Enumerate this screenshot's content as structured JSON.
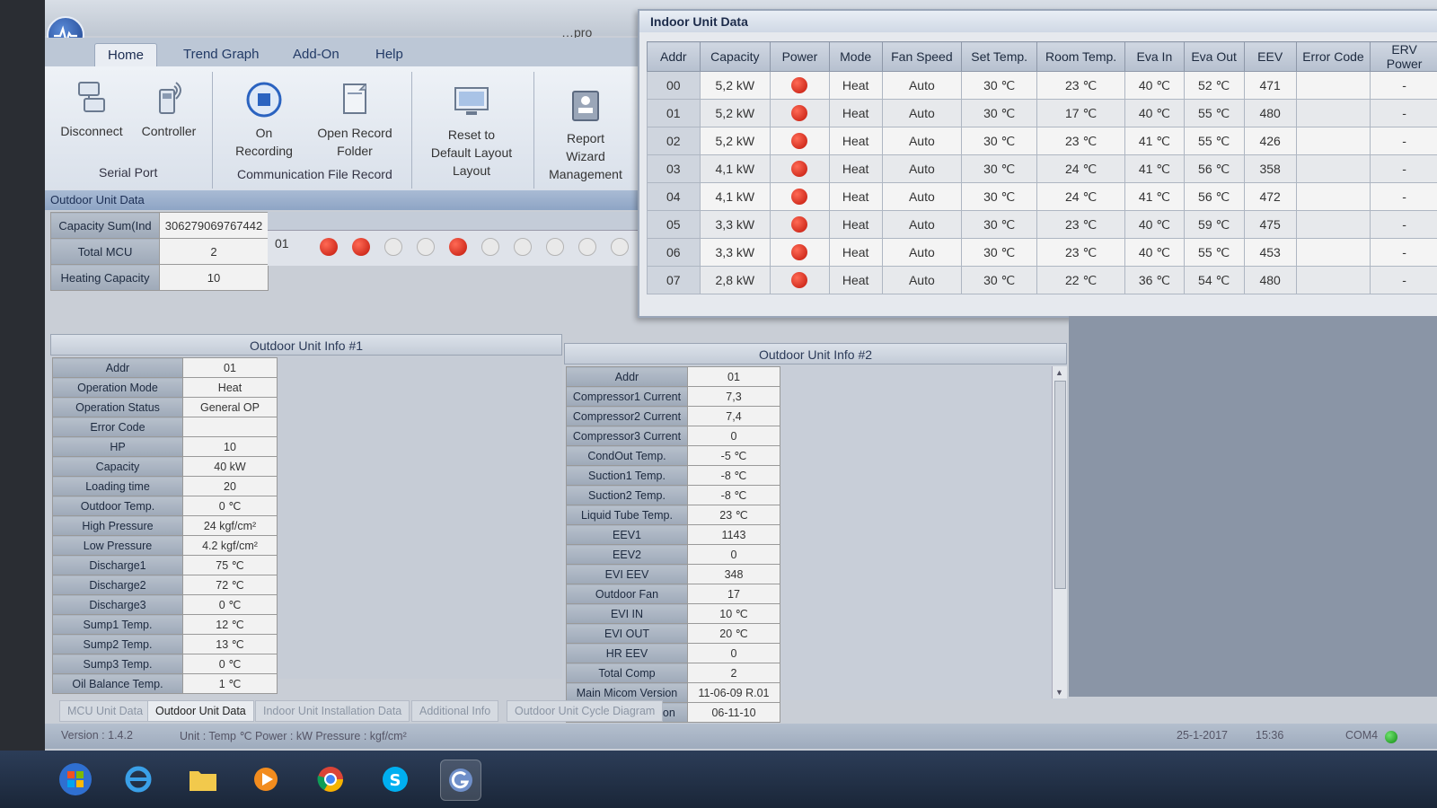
{
  "window": {
    "title": "…pro"
  },
  "tabs": [
    "Home",
    "Trend Graph",
    "Add-On",
    "Help"
  ],
  "ribbon": {
    "disconnect": "Disconnect",
    "controller": "Controller",
    "group_serial": "Serial Port",
    "on_recording_1": "On",
    "on_recording_2": "Recording",
    "open_folder_1": "Open Record",
    "open_folder_2": "Folder",
    "group_comm": "Communication File Record",
    "reset_1": "Reset to",
    "reset_2": "Default Layout",
    "group_layout": "Layout",
    "report_1": "Report",
    "report_2": "Wizard",
    "group_mgmt": "Management"
  },
  "outdoor_summary": {
    "header": "Outdoor Unit Data",
    "rows": [
      {
        "label": "Capacity Sum(Ind",
        "value": "306279069767442"
      },
      {
        "label": "Total MCU",
        "value": "2"
      },
      {
        "label": "Heating Capacity",
        "value": "10"
      }
    ],
    "mcu_addr": "01",
    "mcu_leds": [
      true,
      true,
      false,
      false,
      true,
      false,
      false,
      false,
      false,
      false
    ]
  },
  "indoor": {
    "title": "Indoor Unit Data",
    "columns": [
      "Addr",
      "Capacity",
      "Power",
      "Mode",
      "Fan Speed",
      "Set Temp.",
      "Room Temp.",
      "Eva In",
      "Eva Out",
      "EEV",
      "Error Code",
      "ERV Power"
    ],
    "rows": [
      {
        "addr": "00",
        "capacity": "5,2 kW",
        "mode": "Heat",
        "fan": "Auto",
        "set": "30 ℃",
        "room": "23 ℃",
        "eva_in": "40 ℃",
        "eva_out": "52 ℃",
        "eev": "471",
        "err": "",
        "erv": "-"
      },
      {
        "addr": "01",
        "capacity": "5,2 kW",
        "mode": "Heat",
        "fan": "Auto",
        "set": "30 ℃",
        "room": "17 ℃",
        "eva_in": "40 ℃",
        "eva_out": "55 ℃",
        "eev": "480",
        "err": "",
        "erv": "-"
      },
      {
        "addr": "02",
        "capacity": "5,2 kW",
        "mode": "Heat",
        "fan": "Auto",
        "set": "30 ℃",
        "room": "23 ℃",
        "eva_in": "41 ℃",
        "eva_out": "55 ℃",
        "eev": "426",
        "err": "",
        "erv": "-"
      },
      {
        "addr": "03",
        "capacity": "4,1 kW",
        "mode": "Heat",
        "fan": "Auto",
        "set": "30 ℃",
        "room": "24 ℃",
        "eva_in": "41 ℃",
        "eva_out": "56 ℃",
        "eev": "358",
        "err": "",
        "erv": "-"
      },
      {
        "addr": "04",
        "capacity": "4,1 kW",
        "mode": "Heat",
        "fan": "Auto",
        "set": "30 ℃",
        "room": "24 ℃",
        "eva_in": "41 ℃",
        "eva_out": "56 ℃",
        "eev": "472",
        "err": "",
        "erv": "-"
      },
      {
        "addr": "05",
        "capacity": "3,3 kW",
        "mode": "Heat",
        "fan": "Auto",
        "set": "30 ℃",
        "room": "23 ℃",
        "eva_in": "40 ℃",
        "eva_out": "59 ℃",
        "eev": "475",
        "err": "",
        "erv": "-"
      },
      {
        "addr": "06",
        "capacity": "3,3 kW",
        "mode": "Heat",
        "fan": "Auto",
        "set": "30 ℃",
        "room": "23 ℃",
        "eva_in": "40 ℃",
        "eva_out": "55 ℃",
        "eev": "453",
        "err": "",
        "erv": "-"
      },
      {
        "addr": "07",
        "capacity": "2,8 kW",
        "mode": "Heat",
        "fan": "Auto",
        "set": "30 ℃",
        "room": "22 ℃",
        "eva_in": "36 ℃",
        "eva_out": "54 ℃",
        "eev": "480",
        "err": "",
        "erv": "-"
      }
    ]
  },
  "info1": {
    "title": "Outdoor Unit Info #1",
    "rows": [
      [
        "Addr",
        "01"
      ],
      [
        "Operation Mode",
        "Heat"
      ],
      [
        "Operation Status",
        "General OP"
      ],
      [
        "Error Code",
        ""
      ],
      [
        "HP",
        "10"
      ],
      [
        "Capacity",
        "40 kW"
      ],
      [
        "Loading time",
        "20"
      ],
      [
        "Outdoor Temp.",
        "0 ℃"
      ],
      [
        "High Pressure",
        "24 kgf/cm²"
      ],
      [
        "Low Pressure",
        "4.2 kgf/cm²"
      ],
      [
        "Discharge1",
        "75 ℃"
      ],
      [
        "Discharge2",
        "72 ℃"
      ],
      [
        "Discharge3",
        "0 ℃"
      ],
      [
        "Sump1 Temp.",
        "12 ℃"
      ],
      [
        "Sump2 Temp.",
        "13 ℃"
      ],
      [
        "Sump3 Temp.",
        "0 ℃"
      ],
      [
        "Oil Balance Temp.",
        "1 ℃"
      ]
    ]
  },
  "info2": {
    "title": "Outdoor Unit Info #2",
    "rows": [
      [
        "Addr",
        "01"
      ],
      [
        "Compressor1 Current",
        "7,3"
      ],
      [
        "Compressor2 Current",
        "7,4"
      ],
      [
        "Compressor3 Current",
        "0"
      ],
      [
        "CondOut Temp.",
        "-5 ℃"
      ],
      [
        "Suction1 Temp.",
        "-8 ℃"
      ],
      [
        "Suction2 Temp.",
        "-8 ℃"
      ],
      [
        "Liquid Tube Temp.",
        "23 ℃"
      ],
      [
        "EEV1",
        "1143"
      ],
      [
        "EEV2",
        "0"
      ],
      [
        "EVI EEV",
        "348"
      ],
      [
        "Outdoor Fan",
        "17"
      ],
      [
        "EVI IN",
        "10 ℃"
      ],
      [
        "EVI OUT",
        "20 ℃"
      ],
      [
        "HR EEV",
        "0"
      ],
      [
        "Total Comp",
        "2"
      ],
      [
        "Main Micom Version",
        "11-06-09 R.01"
      ],
      [
        "Sub Micom Version",
        "06-11-10"
      ]
    ]
  },
  "bottom_tabs": [
    "MCU Unit Data",
    "Outdoor Unit Data",
    "Indoor Unit Installation Data",
    "Additional Info",
    "Outdoor Unit Cycle Diagram"
  ],
  "status": {
    "version": "Version : 1.4.2",
    "units": "Unit : Temp ℃  Power : kW  Pressure : kgf/cm²",
    "date": "25-1-2017",
    "time": "15:36",
    "port": "COM4"
  },
  "colors": {
    "power_on": "#c0160a",
    "com_ok": "#118a11",
    "accent": "#223a66"
  }
}
